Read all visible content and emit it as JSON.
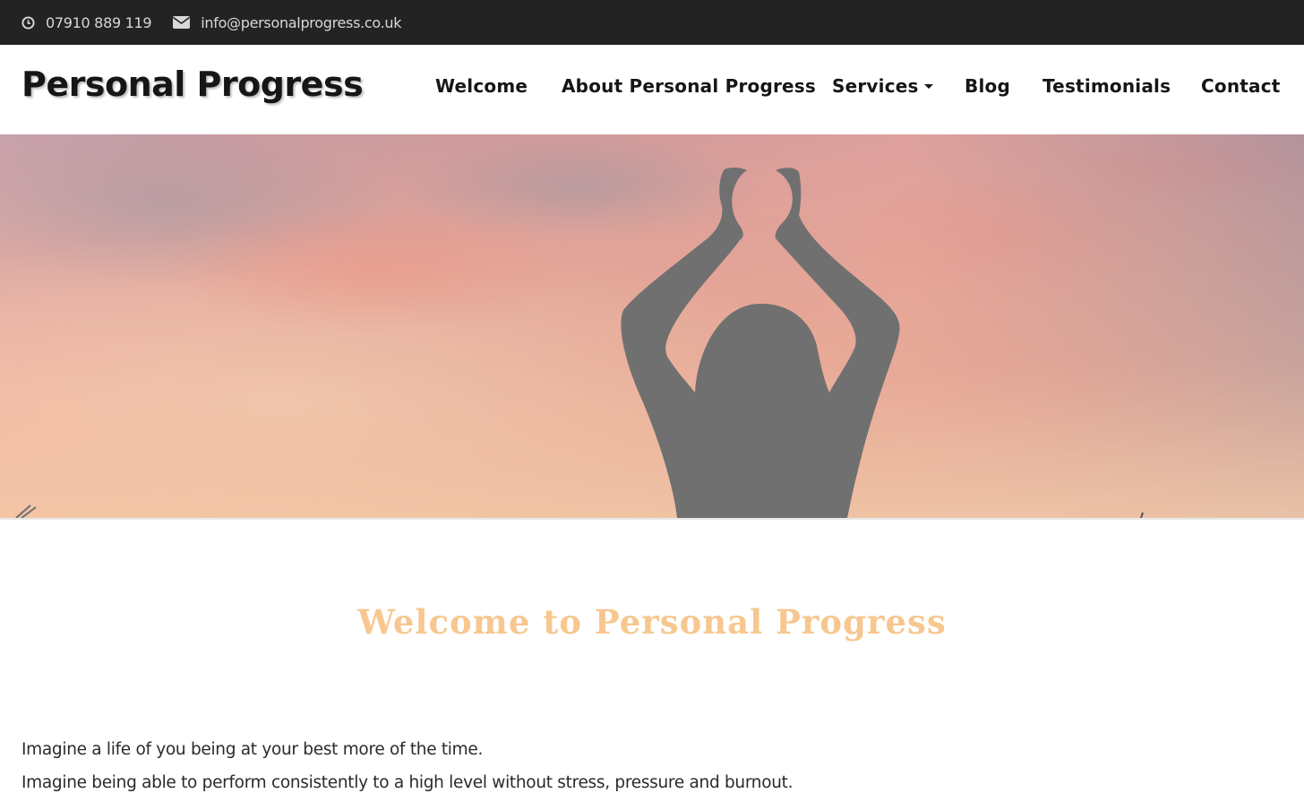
{
  "topbar": {
    "phone": "07910 889 119",
    "email": "info@personalprogress.co.uk",
    "phone_icon": "clock-icon",
    "email_icon": "envelope-icon"
  },
  "header": {
    "logo": "Personal Progress",
    "nav": [
      {
        "label": "Welcome"
      },
      {
        "label": "About Personal Progress"
      },
      {
        "label": "Services",
        "has_dropdown": true
      },
      {
        "label": "Blog"
      },
      {
        "label": "Testimonials"
      },
      {
        "label": "Contact"
      }
    ]
  },
  "hero": {
    "image": "silhouette-raised-arms-sunset-sky"
  },
  "content": {
    "heading": "Welcome to Personal Progress",
    "paragraphs": [
      "Imagine a life of you being at your best more of the time.",
      "Imagine being able to perform consistently to a high level without stress, pressure and burnout."
    ]
  },
  "colors": {
    "topbar_bg": "#232323",
    "heading_accent": "#f7c78f",
    "text": "#2a2a2a"
  }
}
